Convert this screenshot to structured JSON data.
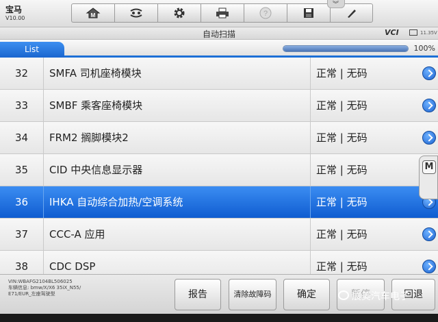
{
  "app": {
    "make": "宝马",
    "version": "V10.00"
  },
  "toolbar": {
    "buttons": [
      {
        "icon": "home-icon"
      },
      {
        "icon": "vehicle-swap-icon"
      },
      {
        "icon": "gear-icon"
      },
      {
        "icon": "printer-icon"
      },
      {
        "icon": "help-icon"
      },
      {
        "icon": "save-icon"
      },
      {
        "icon": "pen-icon"
      }
    ]
  },
  "status": {
    "title": "自动扫描",
    "vci": "VCI",
    "voltage": "11.35V"
  },
  "tab": {
    "label": "List",
    "progress_percent": 100,
    "progress_text": "100%"
  },
  "list": {
    "rows": [
      {
        "num": "32",
        "name": "SMFA 司机座椅模块",
        "status": "正常 | 无码"
      },
      {
        "num": "33",
        "name": "SMBF 乘客座椅模块",
        "status": "正常 | 无码"
      },
      {
        "num": "34",
        "name": "FRM2 搁脚模块2",
        "status": "正常 | 无码"
      },
      {
        "num": "35",
        "name": "CID 中央信息显示器",
        "status": "正常 | 无码"
      },
      {
        "num": "36",
        "name": "IHKA 自动综合加热/空调系统",
        "status": "正常 | 无码",
        "selected": true
      },
      {
        "num": "37",
        "name": "CCC-A 应用",
        "status": "正常 | 无码"
      },
      {
        "num": "38",
        "name": "CDC DSP",
        "status": "正常 | 无码"
      }
    ]
  },
  "side_tab": {
    "label": "M"
  },
  "vehicle_info": {
    "vin": "VIN:WBAFG2104BL506025",
    "info": "车辆信息: bmw/X/X6 35iX_N55/ E71/EUR_左座驾驶型"
  },
  "actions": {
    "report": "报告",
    "clear_codes": "清除故障码",
    "ok": "确定",
    "pause": "暂停",
    "back": "回退"
  },
  "watermark": "展美汽车电子"
}
